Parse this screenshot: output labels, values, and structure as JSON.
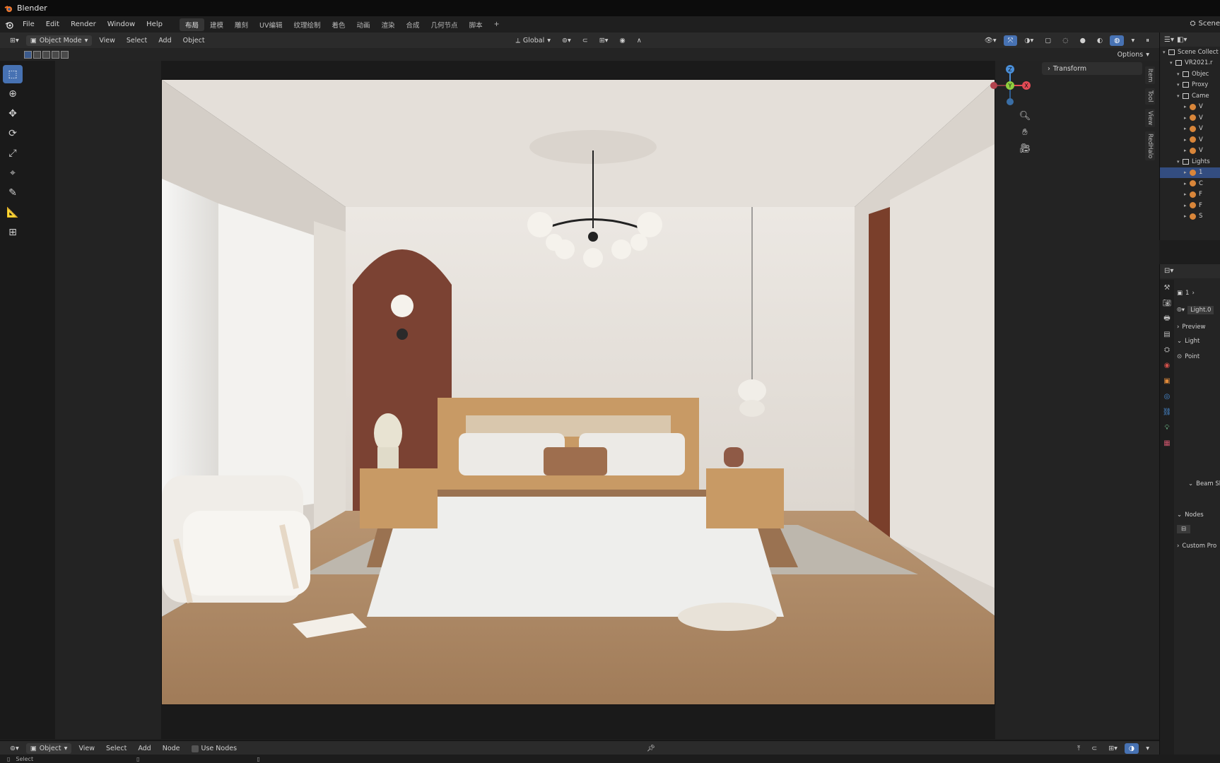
{
  "window": {
    "title": "Blender"
  },
  "menu": {
    "items": [
      "File",
      "Edit",
      "Render",
      "Window",
      "Help"
    ],
    "workspaces": [
      "布局",
      "建模",
      "雕刻",
      "UV编辑",
      "纹理绘制",
      "着色",
      "动画",
      "渲染",
      "合成",
      "几何节点",
      "脚本"
    ],
    "active_workspace": "布局",
    "add_tab": "+",
    "scene": "Scene"
  },
  "viewport_header": {
    "mode": "Object Mode",
    "menus": [
      "View",
      "Select",
      "Add",
      "Object"
    ],
    "orientation": "Global",
    "options": "Options"
  },
  "sidebar": {
    "transform_label": "Transform",
    "tabs": [
      "Item",
      "Tool",
      "View",
      "RedHalo"
    ]
  },
  "gizmo": {
    "z": "Z",
    "y": "Y",
    "x": "X"
  },
  "outliner": {
    "rows": [
      {
        "label": "Scene Collect",
        "indent": 0,
        "type": "collection"
      },
      {
        "label": "VR2021.r",
        "indent": 1,
        "type": "collection"
      },
      {
        "label": "Objec",
        "indent": 2,
        "type": "collection"
      },
      {
        "label": "Proxy",
        "indent": 2,
        "type": "collection"
      },
      {
        "label": "Came",
        "indent": 2,
        "type": "collection"
      },
      {
        "label": "V",
        "indent": 3,
        "type": "object"
      },
      {
        "label": "V",
        "indent": 3,
        "type": "object"
      },
      {
        "label": "V",
        "indent": 3,
        "type": "object"
      },
      {
        "label": "V",
        "indent": 3,
        "type": "object"
      },
      {
        "label": "V",
        "indent": 3,
        "type": "object"
      },
      {
        "label": "Lights",
        "indent": 2,
        "type": "collection"
      },
      {
        "label": "1",
        "indent": 3,
        "type": "object",
        "selected": true
      },
      {
        "label": "C",
        "indent": 3,
        "type": "object"
      },
      {
        "label": "F",
        "indent": 3,
        "type": "object"
      },
      {
        "label": "F",
        "indent": 3,
        "type": "object"
      },
      {
        "label": "S",
        "indent": 3,
        "type": "object"
      }
    ]
  },
  "properties": {
    "users": "1",
    "datablock": "Light.0",
    "panels": [
      "Preview",
      "Light",
      "Beam Sh",
      "Nodes",
      "Custom Pro"
    ],
    "light_type": "Point"
  },
  "node_header": {
    "mode": "Object",
    "menus": [
      "View",
      "Select",
      "Add",
      "Node"
    ],
    "use_nodes": "Use Nodes"
  },
  "status": {
    "left": "Select"
  }
}
